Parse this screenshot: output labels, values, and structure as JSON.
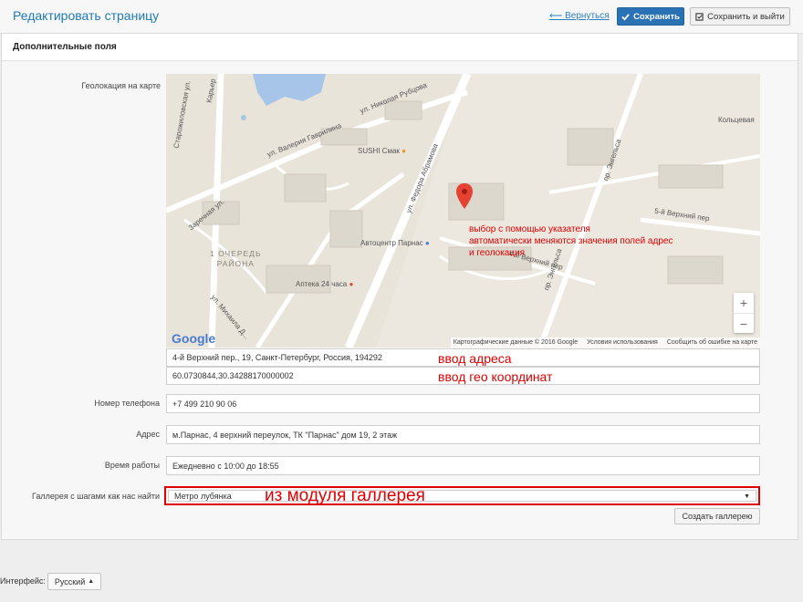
{
  "header": {
    "title": "Редактировать страницу",
    "back_label": "Вернуться",
    "back_arrow": "⟵",
    "save_label": "Сохранить",
    "save_exit_label": "Сохранить и выйти"
  },
  "panel": {
    "title": "Дополнительные поля"
  },
  "map": {
    "label": "Геолокация на карте",
    "streets": {
      "s1": "ул. Николая Рубцова",
      "s2": "ул. Валерия Гаврилина",
      "s3": "ул. Федора Абрамова",
      "s4": "Заречная ул.",
      "s5": "Старожиловская ул.",
      "s6": "ул. Михаила Д...",
      "s7": "пр. Энгельса",
      "s8": "5-й Верхний пер",
      "s9": "4-й Верхний пер",
      "s10": "Кольцевая",
      "s11": "Карьер"
    },
    "district": "1 ОЧЕРЕДЬ\nРАЙОНА",
    "pois": {
      "p1": "SUSHI Смак",
      "p2": "Автоцентр Парнас",
      "p3": "Аптека 24 часа"
    },
    "logo": "Google",
    "zoom_in": "+",
    "zoom_out": "−",
    "attribution": {
      "a1": "Картографические данные © 2016 Google",
      "a2": "Условия использования",
      "a3": "Сообщить об ошибке на карте"
    }
  },
  "annotations": {
    "pin_note": "выбор с помощью указателя\nавтоматически меняются значения полей адрес\nи геолокация",
    "address_note": "ввод адреса",
    "geo_note": "ввод гео координат",
    "gallery_note": "из модуля галлерея"
  },
  "fields": {
    "map_address": "4-й Верхний пер., 19, Санкт-Петербург, Россия, 194292",
    "map_coords": "60.0730844,30.34288170000002",
    "phone_label": "Номер телефона",
    "phone": "+7 499 210 90 06",
    "address_label": "Адрес",
    "address": "м.Парнас, 4 верхний переулок, ТК \"Парнас\" дом 19, 2 этаж",
    "hours_label": "Время работы",
    "hours": "Ежедневно с 10:00 до 18:55",
    "gallery_label": "Галлерея с шагами как нас найти",
    "gallery_value": "Метро лубянка",
    "create_gallery": "Создать галлерею"
  },
  "footer": {
    "interface_label": "Интерфейс:",
    "language": "Русский"
  },
  "colors": {
    "accent": "#2b72b4",
    "annotation": "#e00000"
  }
}
